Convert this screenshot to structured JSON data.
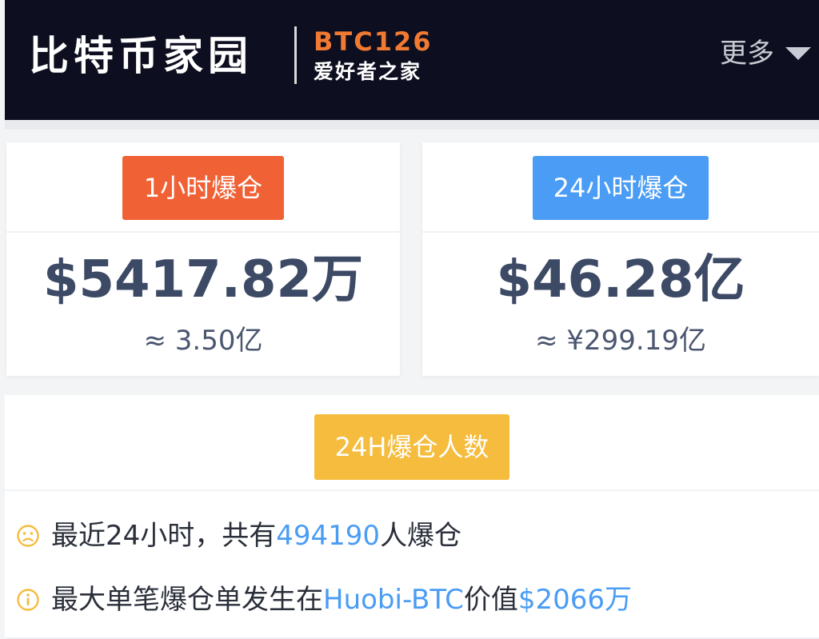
{
  "header": {
    "logo_cn": "比特币家园",
    "logo_en": "BTC126",
    "slogan": "爱好者之家",
    "more_label": "更多",
    "colors": {
      "background": "#0d0e1f",
      "brand_accent": "#f07a32"
    }
  },
  "cards": [
    {
      "tag": "1小时爆仓",
      "amount": "$5417.82万",
      "approx": "≈ 3.50亿",
      "tag_color": "#f06235"
    },
    {
      "tag": "24小时爆仓",
      "amount": "$46.28亿",
      "approx": "≈ ¥299.19亿",
      "tag_color": "#4a9cf4"
    }
  ],
  "people": {
    "tag": "24H爆仓人数",
    "tag_color": "#f5bc3d",
    "line1": {
      "icon": "sad-face-icon",
      "prefix": "最近24小时，共有",
      "count": "494190",
      "suffix": "人爆仓"
    },
    "line2": {
      "icon": "info-circle-icon",
      "prefix": "最大单笔爆仓单发生在",
      "exchange": "Huobi-BTC",
      "mid": "价值",
      "value": "$2066万"
    }
  }
}
